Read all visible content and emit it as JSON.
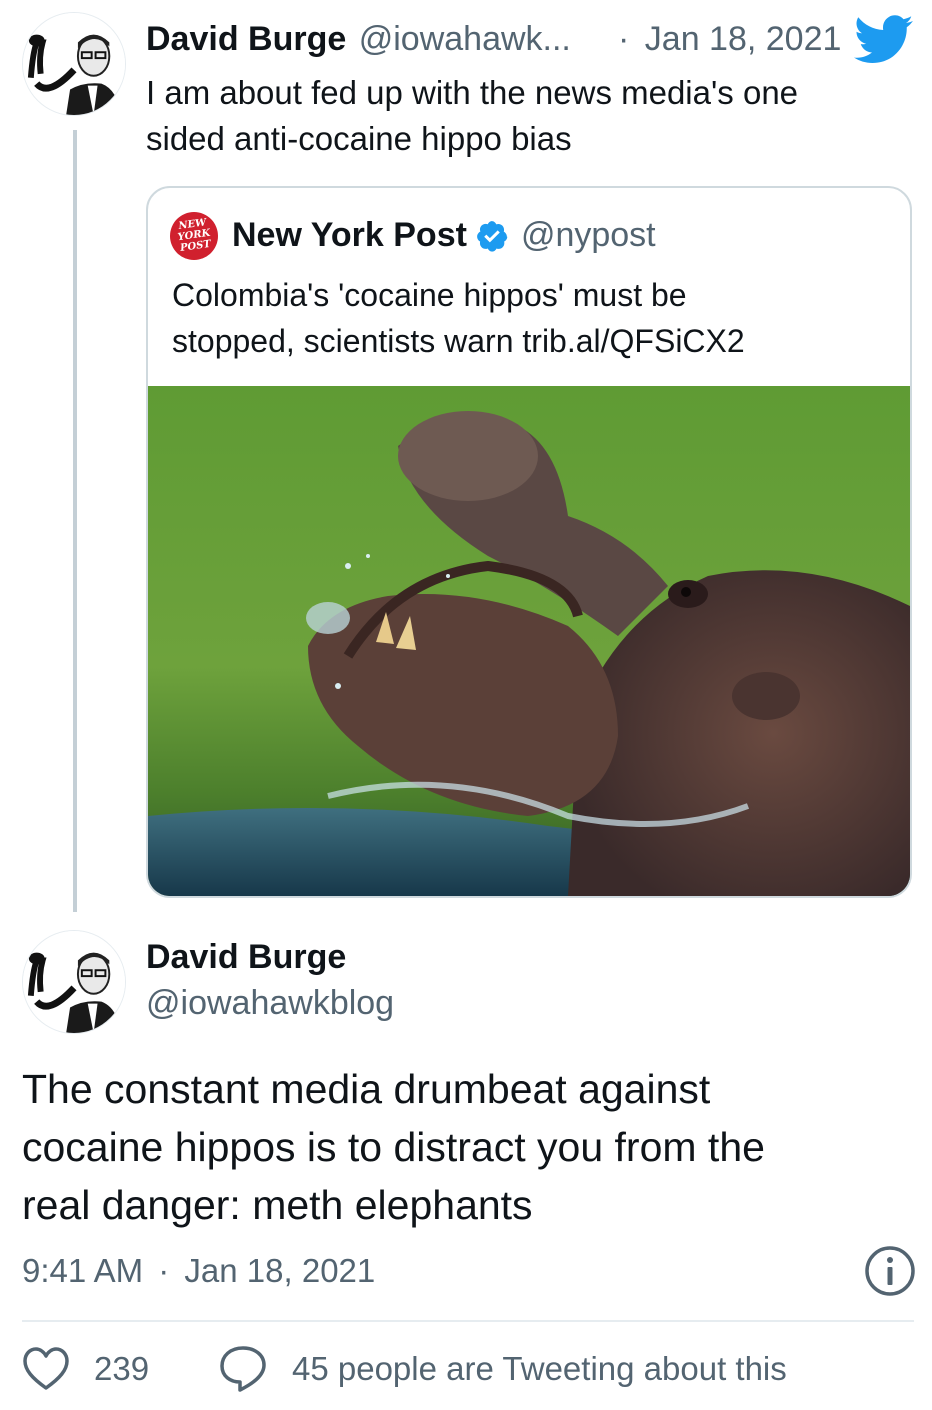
{
  "tweet": {
    "author_name": "David Burge",
    "author_handle": "@iowahawk...",
    "date": "Jan 18, 2021",
    "date_separator": "·",
    "text_line1": "I am about fed up with the news media's one",
    "text_line2": "sided anti-cocaine hippo bias"
  },
  "quoted_tweet": {
    "author_name": "New York Post",
    "author_handle": "@nypost",
    "logo_text": [
      "NEW",
      "YORK",
      "POST"
    ],
    "verified": true,
    "text_line1": "Colombia's 'cocaine hippos' must be",
    "text_line2": "stopped, scientists warn trib.al/QFSiCX2",
    "media_alt": "hippo-photo"
  },
  "main_tweet": {
    "author_name": "David Burge",
    "author_handle": "@iowahawkblog",
    "text_line1": "The constant media drumbeat against",
    "text_line2": "cocaine hippos is to distract you from the",
    "text_line3": "real danger: meth elephants",
    "time": "9:41 AM",
    "meta_separator": "·",
    "date": "Jan 18, 2021"
  },
  "actions": {
    "likes": "239",
    "tweeting_label": "45 people are Tweeting about this"
  },
  "colors": {
    "twitter_blue": "#1d9bf0",
    "nypost_red": "#d0202e",
    "text_primary": "#0f1419",
    "text_secondary": "#536471"
  },
  "icons": [
    "twitter-bird-icon",
    "verified-badge-icon",
    "info-icon",
    "heart-icon",
    "reply-bubble-icon"
  ]
}
